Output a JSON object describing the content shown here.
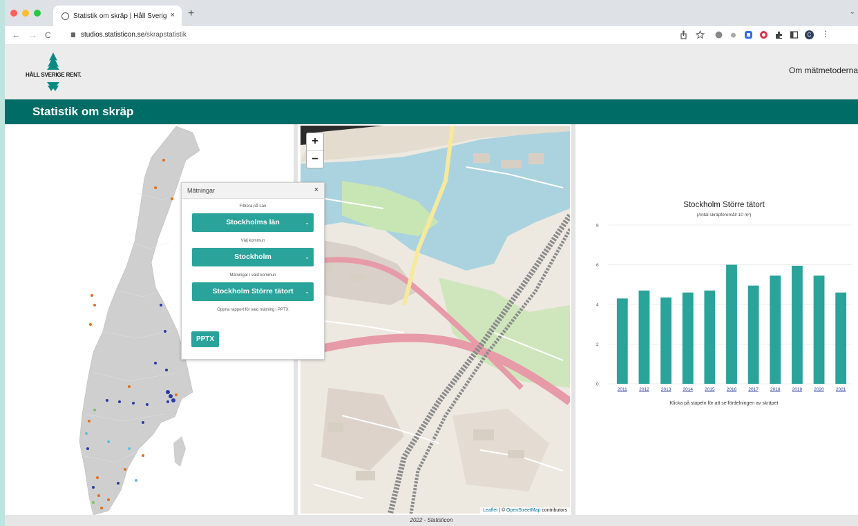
{
  "browser": {
    "tab_title": "Statistik om skräp | Håll Sverig",
    "tab_close": "×",
    "new_tab": "+",
    "url_host": "studios.statisticon.se",
    "url_path": "/skrapstatistik",
    "back": "←",
    "forward": "→",
    "reload": "C",
    "profile_initial": "C"
  },
  "site": {
    "logo_text": "HÅLL SVERIGE RENT.",
    "nav_link": "Om mätmetoderna",
    "page_title": "Statistik om skräp",
    "footer": "2022 - Statisticon"
  },
  "map": {
    "zoom_in": "+",
    "zoom_out": "−",
    "attribution_leaflet": "Leaflet",
    "attribution_sep": " | © ",
    "attribution_osm": "OpenStreetMap",
    "attribution_tail": " contributors"
  },
  "dialog": {
    "title": "Mätningar",
    "close": "×",
    "filter_label": "Filtrera på Län",
    "lan_value": "Stockholms län",
    "kommun_label": "Välj kommun",
    "kommun_value": "Stockholm",
    "matning_label": "Mätningar i vald kommun",
    "matning_value": "Stockholm Större tätort",
    "report_label": "Öppna rapport för vald mätning i PPTX",
    "pptx_button": "PPTX"
  },
  "chart_data": {
    "type": "bar",
    "title": "Stockholm Större tätort",
    "subtitle": "(Antal skräpföremål/ 10 m²)",
    "xlabel": "Klicka på stapeln för att se fördelningen av skräpet",
    "ylabel": "",
    "categories": [
      "2011",
      "2012",
      "2013",
      "2014",
      "2015",
      "2016",
      "2017",
      "2018",
      "2019",
      "2020",
      "2021"
    ],
    "values": [
      4.3,
      4.7,
      4.35,
      4.6,
      4.7,
      6.0,
      4.95,
      5.45,
      5.95,
      5.45,
      4.6
    ],
    "ylim": [
      0,
      8
    ],
    "yticks": [
      0,
      2,
      4,
      6,
      8
    ],
    "grid": true,
    "bar_color": "#2aa39a"
  }
}
